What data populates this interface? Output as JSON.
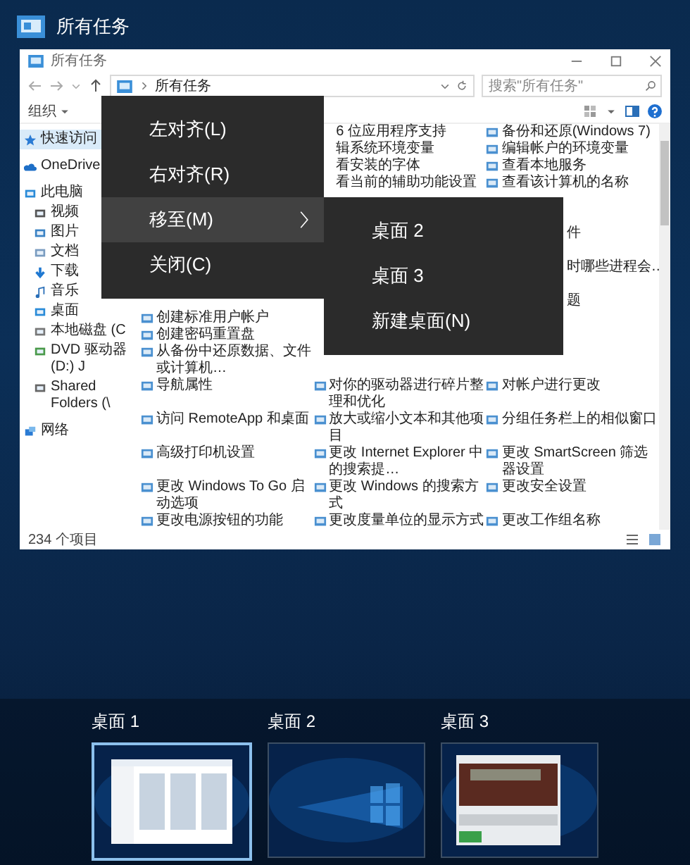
{
  "header": {
    "title": "所有任务"
  },
  "window": {
    "title": "所有任务",
    "address": "所有任务",
    "search_placeholder": "搜索\"所有任务\"",
    "organize": "组织",
    "nav": [
      {
        "label": "快速访问",
        "selected": true
      },
      {
        "label": "OneDrive",
        "selected": false
      },
      {
        "label": "此电脑",
        "selected": false,
        "children": [
          {
            "label": "视频",
            "selected": false
          },
          {
            "label": "图片",
            "selected": false
          },
          {
            "label": "文档",
            "selected": false
          },
          {
            "label": "下载",
            "selected": false
          },
          {
            "label": "音乐",
            "selected": false
          },
          {
            "label": "桌面",
            "selected": false
          },
          {
            "label": "本地磁盘 (C",
            "selected": false
          },
          {
            "label": "DVD 驱动器 (D:) J",
            "selected": false
          },
          {
            "label": "Shared Folders (\\",
            "selected": false
          }
        ]
      },
      {
        "label": "网络",
        "selected": false
      }
    ],
    "top_rows": [
      {
        "col_2": "6 位应用程序支持",
        "col_3": "备份和还原(Windows 7)"
      },
      {
        "col_2": "辑系统环境变量",
        "col_3": "编辑帐户的环境变量"
      },
      {
        "col_2": "看安装的字体",
        "col_3": "查看本地服务"
      },
      {
        "col_2": "看当前的辅助功能设置",
        "col_3": "查看该计算机的名称"
      }
    ],
    "partial_rows": [
      "件",
      "时哪些进程会…",
      "题"
    ],
    "bottom_rows": [
      {
        "col_1": "创建标准用户帐户"
      },
      {
        "col_1": "创建密码重置盘"
      },
      {
        "col_1": "从备份中还原数据、文件或计算机…"
      },
      {
        "col_1": "导航属性",
        "col_2": "对你的驱动器进行碎片整理和优化",
        "col_3": "对帐户进行更改"
      },
      {
        "col_1": "访问 RemoteApp 和桌面",
        "col_2": "放大或缩小文本和其他项目",
        "col_3": "分组任务栏上的相似窗口"
      },
      {
        "col_1": "高级打印机设置",
        "col_2": "更改 Internet Explorer 中的搜索提…",
        "col_3": "更改 SmartScreen 筛选器设置"
      },
      {
        "col_1": "更改 Windows To Go 启动选项",
        "col_2": "更改 Windows 的搜索方式",
        "col_3": "更改安全设置"
      },
      {
        "col_1": "更改电源按钮的功能",
        "col_2": "更改度量单位的显示方式",
        "col_3": "更改工作组名称"
      }
    ],
    "status": "234 个项目"
  },
  "context_menu": [
    {
      "label": "左对齐(L)",
      "selected": false,
      "has_submenu": false
    },
    {
      "label": "右对齐(R)",
      "selected": false,
      "has_submenu": false
    },
    {
      "label": "移至(M)",
      "selected": true,
      "has_submenu": true
    },
    {
      "label": "关闭(C)",
      "selected": false,
      "has_submenu": false
    }
  ],
  "submenu": [
    {
      "label": "桌面 2"
    },
    {
      "label": "桌面 3"
    },
    {
      "label": "新建桌面(N)"
    }
  ],
  "desktops": [
    {
      "label": "桌面 1",
      "selected": true,
      "kind": "picture"
    },
    {
      "label": "桌面 2",
      "selected": false,
      "kind": "picture"
    },
    {
      "label": "桌面 3",
      "selected": false,
      "kind": "picture"
    }
  ]
}
